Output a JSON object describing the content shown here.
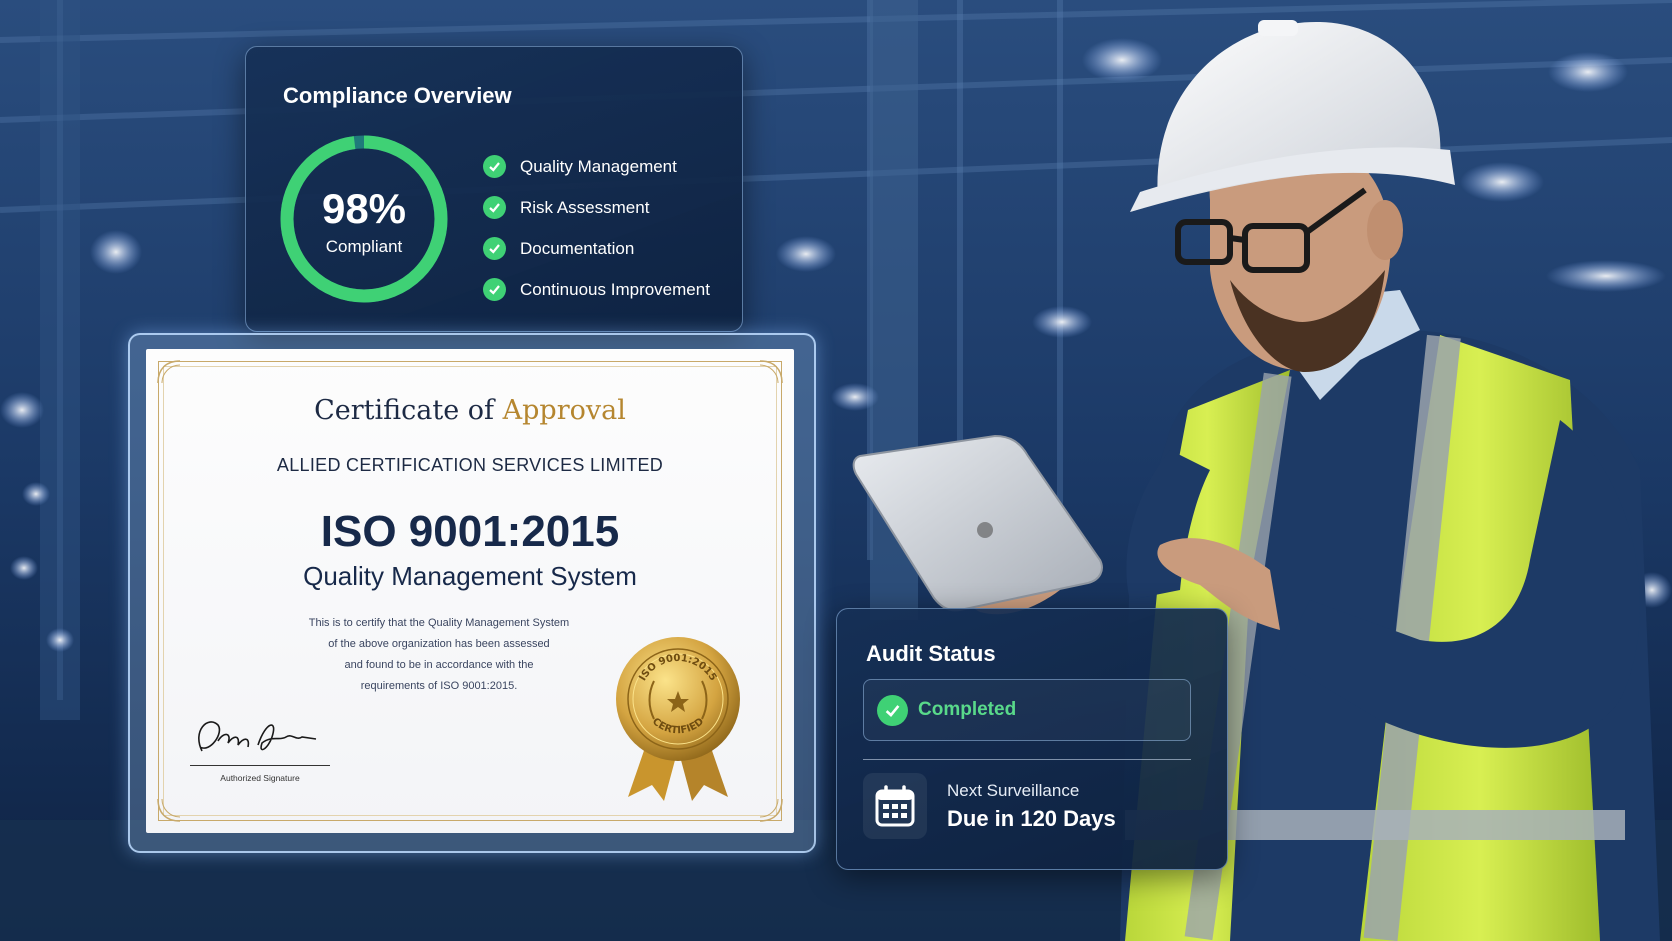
{
  "compliance": {
    "title": "Compliance Overview",
    "percent_value": 98,
    "percent_text": "98%",
    "percent_caption": "Compliant",
    "items": [
      {
        "label": "Quality Management"
      },
      {
        "label": "Risk Assessment"
      },
      {
        "label": "Documentation"
      },
      {
        "label": "Continuous Improvement"
      }
    ]
  },
  "certificate": {
    "title_part1": "Certificate of",
    "title_part2": "Approval",
    "organization": "ALLIED CERTIFICATION SERVICES LIMITED",
    "standard": "ISO 9001:2015",
    "system": "Quality Management System",
    "body_lines": [
      "This is to certify that the Quality Management System",
      "of the above organization has been assessed",
      "and found to be in accordance with the",
      "requirements of ISO 9001:2015."
    ],
    "signature_label": "Authorized Signature",
    "seal_top_text": "ISO 9001:2015",
    "seal_bottom_text": "CERTIFIED"
  },
  "audit": {
    "title": "Audit Status",
    "status": "Completed",
    "next_label": "Next Surveillance",
    "next_value": "Due in 120 Days"
  },
  "colors": {
    "accent_green": "#3fd175",
    "gold": "#b5862f",
    "navy": "#17294a"
  },
  "icons": [
    "check-icon",
    "calendar-icon",
    "gold-seal-icon",
    "signature"
  ]
}
